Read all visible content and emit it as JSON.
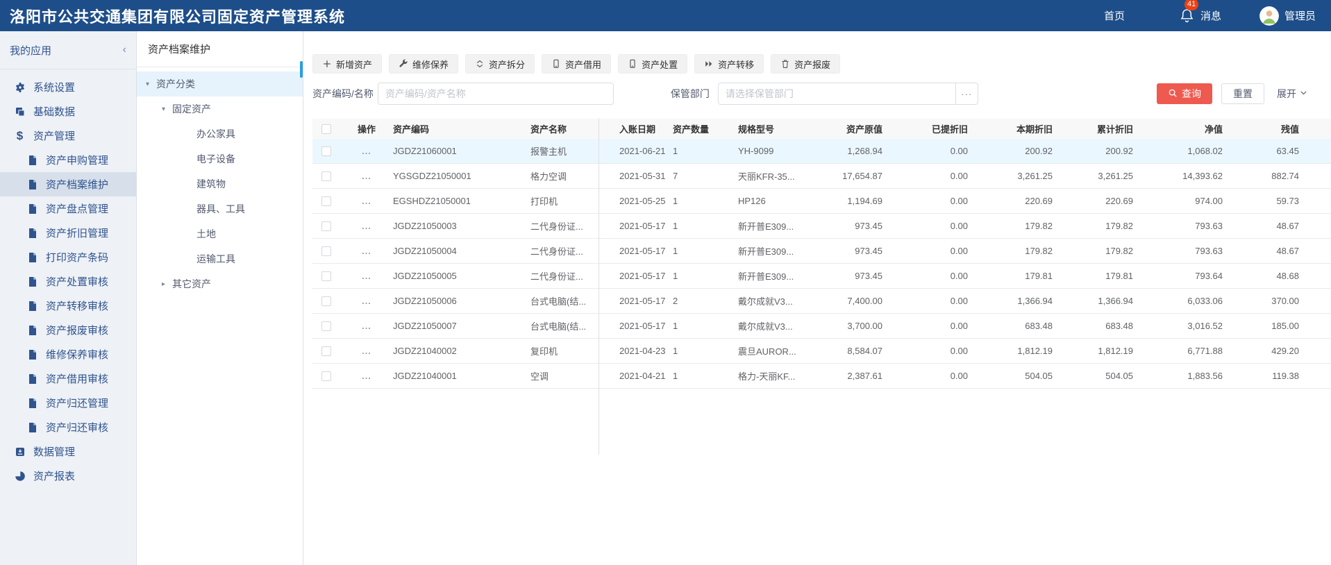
{
  "header": {
    "title": "洛阳市公共交通集团有限公司固定资产管理系统",
    "home_label": "首页",
    "messages_label": "消息",
    "messages_count": "41",
    "user_label": "管理员"
  },
  "sidebar": {
    "title": "我的应用",
    "items": [
      {
        "label": "系统设置",
        "icon": "gear",
        "level": 1,
        "selected": false
      },
      {
        "label": "基础数据",
        "icon": "copy",
        "level": 1,
        "selected": false
      },
      {
        "label": "资产管理",
        "icon": "dollar",
        "level": 1,
        "selected": false
      },
      {
        "label": "资产申购管理",
        "icon": "doc",
        "level": 2,
        "selected": false
      },
      {
        "label": "资产档案维护",
        "icon": "doc",
        "level": 2,
        "selected": true
      },
      {
        "label": "资产盘点管理",
        "icon": "doc",
        "level": 2,
        "selected": false
      },
      {
        "label": "资产折旧管理",
        "icon": "doc",
        "level": 2,
        "selected": false
      },
      {
        "label": "打印资产条码",
        "icon": "doc",
        "level": 2,
        "selected": false
      },
      {
        "label": "资产处置审核",
        "icon": "doc",
        "level": 2,
        "selected": false
      },
      {
        "label": "资产转移审核",
        "icon": "doc",
        "level": 2,
        "selected": false
      },
      {
        "label": "资产报废审核",
        "icon": "doc",
        "level": 2,
        "selected": false
      },
      {
        "label": "维修保养审核",
        "icon": "doc",
        "level": 2,
        "selected": false
      },
      {
        "label": "资产借用审核",
        "icon": "doc",
        "level": 2,
        "selected": false
      },
      {
        "label": "资产归还管理",
        "icon": "doc",
        "level": 2,
        "selected": false
      },
      {
        "label": "资产归还审核",
        "icon": "doc",
        "level": 2,
        "selected": false
      },
      {
        "label": "数据管理",
        "icon": "download",
        "level": 1,
        "selected": false
      },
      {
        "label": "资产报表",
        "icon": "pie",
        "level": 1,
        "selected": false
      }
    ]
  },
  "tree": {
    "title": "资产档案维护",
    "nodes": [
      {
        "label": "资产分类",
        "level": 0,
        "arrow": "down",
        "selected": true
      },
      {
        "label": "固定资产",
        "level": 1,
        "arrow": "down",
        "selected": false
      },
      {
        "label": "办公家具",
        "level": 2,
        "arrow": "none",
        "selected": false
      },
      {
        "label": "电子设备",
        "level": 2,
        "arrow": "none",
        "selected": false
      },
      {
        "label": "建筑物",
        "level": 2,
        "arrow": "none",
        "selected": false
      },
      {
        "label": "器具、工具",
        "level": 2,
        "arrow": "none",
        "selected": false
      },
      {
        "label": "土地",
        "level": 2,
        "arrow": "none",
        "selected": false
      },
      {
        "label": "运输工具",
        "level": 2,
        "arrow": "none",
        "selected": false
      },
      {
        "label": "其它资产",
        "level": 1,
        "arrow": "right",
        "selected": false
      }
    ]
  },
  "toolbar": {
    "buttons": [
      {
        "label": "新增资产",
        "icon": "plus"
      },
      {
        "label": "维修保养",
        "icon": "wrench"
      },
      {
        "label": "资产拆分",
        "icon": "split"
      },
      {
        "label": "资产借用",
        "icon": "device"
      },
      {
        "label": "资产处置",
        "icon": "device"
      },
      {
        "label": "资产转移",
        "icon": "forward"
      },
      {
        "label": "资产报废",
        "icon": "trash"
      }
    ]
  },
  "filters": {
    "code_label": "资产编码/名称",
    "code_placeholder": "资产编码/资产名称",
    "dept_label": "保管部门",
    "dept_placeholder": "请选择保管部门",
    "more_button": "···",
    "search_label": "查询",
    "reset_label": "重置",
    "expand_label": "展开"
  },
  "table": {
    "columns": [
      "操作",
      "资产编码",
      "资产名称",
      "入账日期",
      "资产数量",
      "规格型号",
      "资产原值",
      "已提折旧",
      "本期折旧",
      "累计折旧",
      "净值",
      "残值"
    ],
    "rows": [
      {
        "op": "...",
        "code": "JGDZ21060001",
        "name": "报警主机",
        "date": "2021-06-21",
        "qty": "1",
        "model": "YH-9099",
        "orig": "1,268.94",
        "pre": "0.00",
        "cur": "200.92",
        "acc": "200.92",
        "net": "1,068.02",
        "sal": "63.45",
        "selected": true
      },
      {
        "op": "...",
        "code": "YGSGDZ21050001",
        "name": "格力空调",
        "date": "2021-05-31",
        "qty": "7",
        "model": "天丽KFR-35...",
        "orig": "17,654.87",
        "pre": "0.00",
        "cur": "3,261.25",
        "acc": "3,261.25",
        "net": "14,393.62",
        "sal": "882.74",
        "selected": false
      },
      {
        "op": "...",
        "code": "EGSHDZ21050001",
        "name": "打印机",
        "date": "2021-05-25",
        "qty": "1",
        "model": "HP126",
        "orig": "1,194.69",
        "pre": "0.00",
        "cur": "220.69",
        "acc": "220.69",
        "net": "974.00",
        "sal": "59.73",
        "selected": false
      },
      {
        "op": "...",
        "code": "JGDZ21050003",
        "name": "二代身份证...",
        "date": "2021-05-17",
        "qty": "1",
        "model": "新开普E309...",
        "orig": "973.45",
        "pre": "0.00",
        "cur": "179.82",
        "acc": "179.82",
        "net": "793.63",
        "sal": "48.67",
        "selected": false
      },
      {
        "op": "...",
        "code": "JGDZ21050004",
        "name": "二代身份证...",
        "date": "2021-05-17",
        "qty": "1",
        "model": "新开普E309...",
        "orig": "973.45",
        "pre": "0.00",
        "cur": "179.82",
        "acc": "179.82",
        "net": "793.63",
        "sal": "48.67",
        "selected": false
      },
      {
        "op": "...",
        "code": "JGDZ21050005",
        "name": "二代身份证...",
        "date": "2021-05-17",
        "qty": "1",
        "model": "新开普E309...",
        "orig": "973.45",
        "pre": "0.00",
        "cur": "179.81",
        "acc": "179.81",
        "net": "793.64",
        "sal": "48.68",
        "selected": false
      },
      {
        "op": "...",
        "code": "JGDZ21050006",
        "name": "台式电脑(结...",
        "date": "2021-05-17",
        "qty": "2",
        "model": "戴尔成就V3...",
        "orig": "7,400.00",
        "pre": "0.00",
        "cur": "1,366.94",
        "acc": "1,366.94",
        "net": "6,033.06",
        "sal": "370.00",
        "selected": false
      },
      {
        "op": "...",
        "code": "JGDZ21050007",
        "name": "台式电脑(结...",
        "date": "2021-05-17",
        "qty": "1",
        "model": "戴尔成就V3...",
        "orig": "3,700.00",
        "pre": "0.00",
        "cur": "683.48",
        "acc": "683.48",
        "net": "3,016.52",
        "sal": "185.00",
        "selected": false
      },
      {
        "op": "...",
        "code": "JGDZ21040002",
        "name": "复印机",
        "date": "2021-04-23",
        "qty": "1",
        "model": "震旦AUROR...",
        "orig": "8,584.07",
        "pre": "0.00",
        "cur": "1,812.19",
        "acc": "1,812.19",
        "net": "6,771.88",
        "sal": "429.20",
        "selected": false
      },
      {
        "op": "...",
        "code": "JGDZ21040001",
        "name": "空调",
        "date": "2021-04-21",
        "qty": "1",
        "model": "格力-天丽KF...",
        "orig": "2,387.61",
        "pre": "0.00",
        "cur": "504.05",
        "acc": "504.05",
        "net": "1,883.56",
        "sal": "119.38",
        "selected": false
      }
    ]
  },
  "colors": {
    "header_blue": "#1d4e89",
    "badge_red": "#ed4014",
    "search_red": "#ee5a4f",
    "sidebar_text_blue": "#2f548e",
    "selected_row_blue": "#ebf7ff",
    "tree_scroll_blue": "#2b9fe0"
  }
}
